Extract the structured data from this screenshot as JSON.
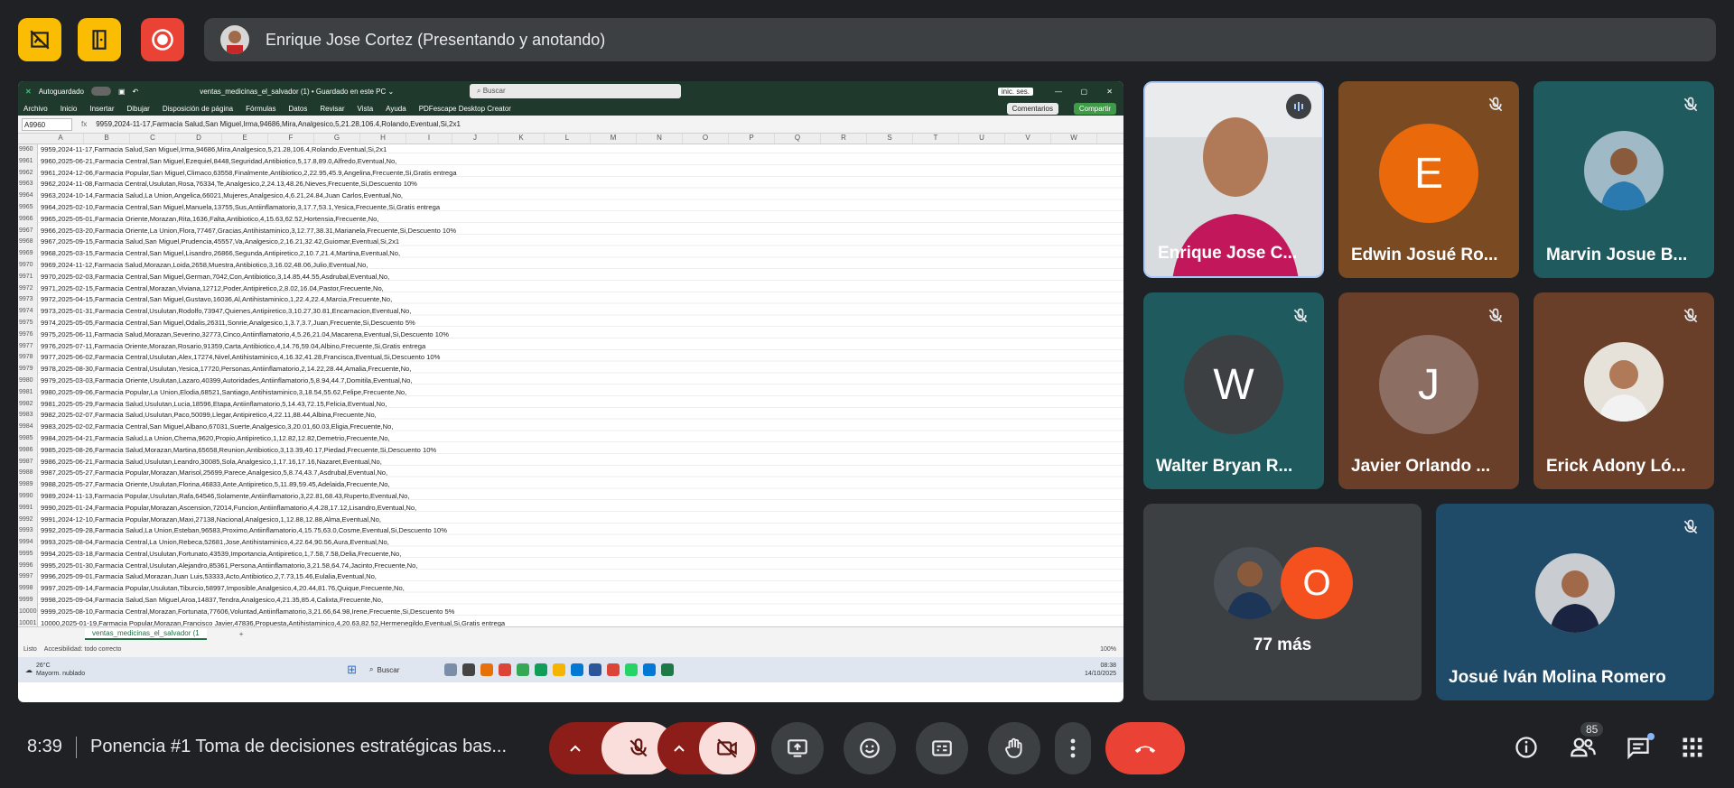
{
  "presenter": {
    "name": "Enrique Jose Cortez (Presentando y anotando)"
  },
  "excel": {
    "autosave": "Autoguardado",
    "filename": "ventas_medicinas_el_salvador (1) • Guardado en este PC ⌄",
    "search_placeholder": "Buscar",
    "account": "inic. ses.",
    "menu": [
      "Archivo",
      "Inicio",
      "Insertar",
      "Dibujar",
      "Disposición de página",
      "Fórmulas",
      "Datos",
      "Revisar",
      "Vista",
      "Ayuda",
      "PDFescape Desktop Creator"
    ],
    "comments_label": "Comentarios",
    "share_label": "Compartir",
    "namebox": "A9960",
    "formula": "9959,2024-11-17,Farmacia Salud,San Miguel,Irma,94686,Mira,Analgesico,5,21.28,106.4,Rolando,Eventual,Si,2x1",
    "columns": [
      "A",
      "B",
      "C",
      "D",
      "E",
      "F",
      "G",
      "H",
      "I",
      "J",
      "K",
      "L",
      "M",
      "N",
      "O",
      "P",
      "Q",
      "R",
      "S",
      "T",
      "U",
      "V",
      "W"
    ],
    "rows": [
      {
        "n": "9960",
        "t": "9959,2024-11-17,Farmacia Salud,San Miguel,Irma,94686,Mira,Analgesico,5,21.28,106.4,Rolando,Eventual,Si,2x1"
      },
      {
        "n": "9961",
        "t": "9960,2025-06-21,Farmacia Central,San Miguel,Ezequiel,8448,Seguridad,Antibiotico,5,17.8,89.0,Alfredo,Eventual,No,"
      },
      {
        "n": "9962",
        "t": "9961,2024-12-06,Farmacia Popular,San Miguel,Climaco,63558,Finalmente,Antibiotico,2,22.95,45.9,Angelina,Frecuente,Si,Gratis entrega"
      },
      {
        "n": "9963",
        "t": "9962,2024-11-08,Farmacia Central,Usulutan,Rosa,76334,Te,Analgesico,2,24.13,48.26,Nieves,Frecuente,Si,Descuento 10%"
      },
      {
        "n": "9964",
        "t": "9963,2024-10-14,Farmacia Salud,La Union,Angelica,66021,Mujeres,Analgesico,4,6.21,24.84,Juan Carlos,Eventual,No,"
      },
      {
        "n": "9965",
        "t": "9964,2025-02-10,Farmacia Central,San Miguel,Manuela,13755,Sus,Antiinflamatorio,3,17.7,53.1,Yesica,Frecuente,Si,Gratis entrega"
      },
      {
        "n": "9966",
        "t": "9965,2025-05-01,Farmacia Oriente,Morazan,Rita,1636,Falta,Antibiotico,4,15.63,62.52,Hortensia,Frecuente,No,"
      },
      {
        "n": "9967",
        "t": "9966,2025-03-20,Farmacia Oriente,La Union,Flora,77467,Gracias,Antihistaminico,3,12.77,38.31,Marianela,Frecuente,Si,Descuento 10%"
      },
      {
        "n": "9968",
        "t": "9967,2025-09-15,Farmacia Salud,San Miguel,Prudencia,45557,Va,Analgesico,2,16.21,32.42,Guiomar,Eventual,Si,2x1"
      },
      {
        "n": "9969",
        "t": "9968,2025-03-15,Farmacia Central,San Miguel,Lisandro,26866,Segunda,Antipiretico,2,10.7,21.4,Martina,Eventual,No,"
      },
      {
        "n": "9970",
        "t": "9969,2024-11-12,Farmacia Salud,Morazan,Loida,2658,Muestra,Antibiotico,3,16.02,48.06,Julio,Eventual,No,"
      },
      {
        "n": "9971",
        "t": "9970,2025-02-03,Farmacia Central,San Miguel,German,7042,Con,Antibiotico,3,14.85,44.55,Asdrubal,Eventual,No,"
      },
      {
        "n": "9972",
        "t": "9971,2025-02-15,Farmacia Central,Morazan,Viviana,12712,Poder,Antipiretico,2,8.02,16.04,Pastor,Frecuente,No,"
      },
      {
        "n": "9973",
        "t": "9972,2025-04-15,Farmacia Central,San Miguel,Gustavo,16036,Al,Antihistaminico,1,22.4,22.4,Marcia,Frecuente,No,"
      },
      {
        "n": "9974",
        "t": "9973,2025-01-31,Farmacia Central,Usulutan,Rodolfo,73947,Quienes,Antipiretico,3,10.27,30.81,Encarnacion,Eventual,No,"
      },
      {
        "n": "9975",
        "t": "9974,2025-05-05,Farmacia Central,San Miguel,Odalis,26311,Sonrie,Analgesico,1,3.7,3.7,Juan,Frecuente,Si,Descuento 5%"
      },
      {
        "n": "9976",
        "t": "9975,2025-06-11,Farmacia Salud,Morazan,Severino,32773,Cinco,Antiinflamatorio,4,5.26,21.04,Macarena,Eventual,Si,Descuento 10%"
      },
      {
        "n": "9977",
        "t": "9976,2025-07-11,Farmacia Oriente,Morazan,Rosario,91359,Carta,Antibiotico,4,14.76,59.04,Albino,Frecuente,Si,Gratis entrega"
      },
      {
        "n": "9978",
        "t": "9977,2025-06-02,Farmacia Central,Usulutan,Alex,17274,Nivel,Antihistaminico,4,16.32,41.28,Francisca,Eventual,Si,Descuento 10%"
      },
      {
        "n": "9979",
        "t": "9978,2025-08-30,Farmacia Central,Usulutan,Yesica,17720,Personas,Antiinflamatorio,2,14.22,28.44,Amalia,Frecuente,No,"
      },
      {
        "n": "9980",
        "t": "9979,2025-03-03,Farmacia Oriente,Usulutan,Lazaro,40399,Autoridades,Antiinflamatorio,5,8.94,44.7,Domitila,Eventual,No,"
      },
      {
        "n": "9981",
        "t": "9980,2025-09-06,Farmacia Popular,La Union,Elodia,68521,Santiago,Antihistaminico,3,18.54,55.62,Felipe,Frecuente,No,"
      },
      {
        "n": "9982",
        "t": "9981,2025-05-29,Farmacia Salud,Usulutan,Lucia,18596,Etapa,Antiinflamatorio,5,14.43,72.15,Felicia,Eventual,No,"
      },
      {
        "n": "9983",
        "t": "9982,2025-02-07,Farmacia Salud,Usulutan,Paco,50099,Llegar,Antipiretico,4,22.11,88.44,Albina,Frecuente,No,"
      },
      {
        "n": "9984",
        "t": "9983,2025-02-02,Farmacia Central,San Miguel,Albano,67031,Suerte,Analgesico,3,20.01,60.03,Eligia,Frecuente,No,"
      },
      {
        "n": "9985",
        "t": "9984,2025-04-21,Farmacia Salud,La Union,Chema,9620,Propio,Antipiretico,1,12.82,12.82,Demetrio,Frecuente,No,"
      },
      {
        "n": "9986",
        "t": "9985,2025-08-26,Farmacia Salud,Morazan,Martina,65658,Reunion,Antibiotico,3,13.39,40.17,Piedad,Frecuente,Si,Descuento 10%"
      },
      {
        "n": "9987",
        "t": "9986,2025-06-21,Farmacia Salud,Usulutan,Leandro,30085,Sola,Analgesico,1,17.16,17.16,Nazaret,Eventual,No,"
      },
      {
        "n": "9988",
        "t": "9987,2025-05-27,Farmacia Popular,Morazan,Marisol,25699,Parece,Analgesico,5,8.74,43.7,Asdrubal,Eventual,No,"
      },
      {
        "n": "9989",
        "t": "9988,2025-05-27,Farmacia Oriente,Usulutan,Florina,46833,Ante,Antipiretico,5,11.89,59.45,Adelaida,Frecuente,No,"
      },
      {
        "n": "9990",
        "t": "9989,2024-11-13,Farmacia Popular,Usulutan,Rafa,64546,Solamente,Antiinflamatorio,3,22.81,68.43,Ruperto,Eventual,No,"
      },
      {
        "n": "9991",
        "t": "9990,2025-01-24,Farmacia Popular,Morazan,Ascension,72014,Funcion,Antiinflamatorio,4,4.28,17.12,Lisandro,Eventual,No,"
      },
      {
        "n": "9992",
        "t": "9991,2024-12-10,Farmacia Popular,Morazan,Maxi,27138,Nacional,Analgesico,1,12.88,12.88,Alma,Eventual,No,"
      },
      {
        "n": "9993",
        "t": "9992,2025-09-28,Farmacia Salud,La Union,Esteban,96583,Proximo,Antiinflamatorio,4,15.75,63.0,Cosme,Eventual,Si,Descuento 10%"
      },
      {
        "n": "9994",
        "t": "9993,2025-08-04,Farmacia Central,La Union,Rebeca,52681,Jose,Antihistaminico,4,22.64,90.56,Aura,Eventual,No,"
      },
      {
        "n": "9995",
        "t": "9994,2025-03-18,Farmacia Central,Usulutan,Fortunato,43539,Importancia,Antipiretico,1,7.58,7.58,Delia,Frecuente,No,"
      },
      {
        "n": "9996",
        "t": "9995,2025-01-30,Farmacia Central,Usulutan,Alejandro,85361,Persona,Antiinflamatorio,3,21.58,64.74,Jacinto,Frecuente,No,"
      },
      {
        "n": "9997",
        "t": "9996,2025-09-01,Farmacia Salud,Morazan,Juan Luis,53333,Acto,Antibiotico,2,7.73,15.46,Eulalia,Eventual,No,"
      },
      {
        "n": "9998",
        "t": "9997,2025-09-14,Farmacia Popular,Usulutan,Tiburcio,58997,Imposible,Analgesico,4,20.44,81.76,Quique,Frecuente,No,"
      },
      {
        "n": "9999",
        "t": "9998,2025-09-04,Farmacia Salud,San Miguel,Aroa,14837,Tendra,Analgesico,4,21.35,85.4,Calixta,Frecuente,No,"
      },
      {
        "n": "10000",
        "t": "9999,2025-08-10,Farmacia Central,Morazan,Fortunata,77606,Voluntad,Antiinflamatorio,3,21.66,64.98,Irene,Frecuente,Si,Descuento 5%"
      },
      {
        "n": "10001",
        "t": "10000,2025-01-19,Farmacia Popular,Morazan,Francisco Javier,47836,Propuesta,Antihistaminico,4,20.63,82.52,Hermenegildo,Eventual,Si,Gratis entrega"
      }
    ],
    "sheet_tab": "ventas_medicinas_el_salvador (1",
    "status_left": "Listo",
    "status_access": "Accesibilidad: todo correcto",
    "zoom": "100%",
    "weather": "26°C",
    "weather_desc": "Mayorm. nublado",
    "taskbar_search": "Buscar",
    "clock_time": "08:38",
    "clock_date": "14/10/2025"
  },
  "participants": [
    {
      "name": "Enrique Jose C...",
      "type": "video",
      "bg": "#c0c4c8",
      "speaking": true
    },
    {
      "name": "Edwin Josué Ro...",
      "type": "letter",
      "letter": "E",
      "bg": "#7a4a22",
      "avatar": "#ea6a0b",
      "muted": true
    },
    {
      "name": "Marvin Josue B...",
      "type": "photo",
      "bg": "#1f5a5e",
      "muted": true
    },
    {
      "name": "Walter Bryan R...",
      "type": "letter",
      "letter": "W",
      "bg": "#1f5a5e",
      "avatar": "#3c4043",
      "muted": true
    },
    {
      "name": "Javier Orlando ...",
      "type": "letter",
      "letter": "J",
      "bg": "#6a3f2a",
      "avatar": "#8d6e63",
      "muted": true
    },
    {
      "name": "Erick Adony Ló...",
      "type": "photo",
      "bg": "#6a3f2a",
      "muted": true
    },
    {
      "name": "77 más",
      "type": "more",
      "letter": "O",
      "avatar": "#f4511e"
    },
    {
      "name": "Josué Iván Molina Romero",
      "type": "photo",
      "bg": "#1f4a68",
      "muted": true
    }
  ],
  "bottom": {
    "clock": "8:39",
    "meeting_title": "Ponencia #1 Toma de decisiones estratégicas bas...",
    "people_count": "85"
  },
  "colors": {
    "hangup": "#ea4335",
    "muted_ctrl": "#f9dedc",
    "yellow": "#fbbc04",
    "red": "#ea4335"
  }
}
